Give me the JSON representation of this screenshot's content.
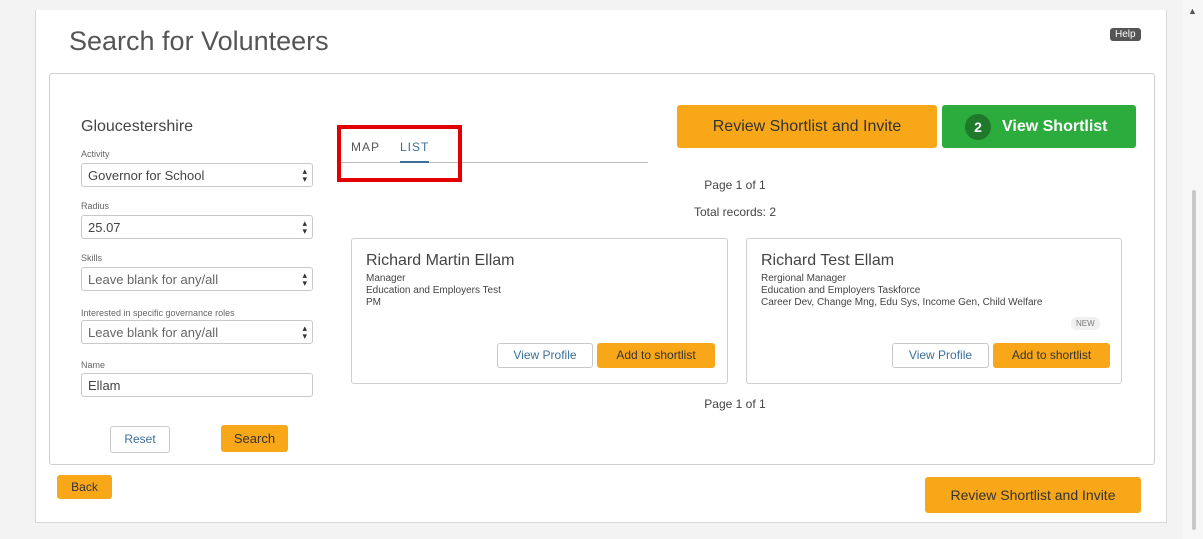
{
  "page": {
    "title": "Search for Volunteers",
    "help_label": "Help"
  },
  "filters": {
    "region": "Gloucestershire",
    "activity_label": "Activity",
    "activity_value": "Governor for School",
    "radius_label": "Radius",
    "radius_value": "25.07",
    "skills_label": "Skills",
    "skills_value": "Leave blank for any/all",
    "roles_label": "Interested in specific governance roles",
    "roles_value": "Leave blank for any/all",
    "name_label": "Name",
    "name_value": "Ellam",
    "reset_label": "Reset",
    "search_label": "Search"
  },
  "tabs": {
    "map": "MAP",
    "list": "LIST",
    "active": "LIST"
  },
  "actions": {
    "review_label": "Review Shortlist and Invite",
    "view_shortlist_label": "View Shortlist",
    "shortlist_count": "2",
    "back_label": "Back"
  },
  "results": {
    "page_top": "Page 1 of 1",
    "total": "Total records: 2",
    "page_bottom": "Page 1 of 1",
    "cards": [
      {
        "name": "Richard Martin Ellam",
        "role": "Manager",
        "organisation": "Education and Employers Test",
        "extra": "PM",
        "badge": "",
        "view_label": "View Profile",
        "add_label": "Add to shortlist"
      },
      {
        "name": "Richard Test Ellam",
        "role": "Rergional Manager",
        "organisation": "Education and Employers Taskforce",
        "extra": "Career Dev, Change Mng, Edu Sys, Income Gen, Child Welfare",
        "badge": "NEW",
        "view_label": "View Profile",
        "add_label": "Add to shortlist"
      }
    ]
  },
  "colors": {
    "accent_orange": "#f8a719",
    "accent_green": "#2dac3e",
    "link_blue": "#3a6f9a",
    "highlight_red": "#e30000"
  },
  "icons": {
    "select_arrows": "updown-arrows-icon",
    "scroll_up": "scroll-up-arrow-icon"
  }
}
